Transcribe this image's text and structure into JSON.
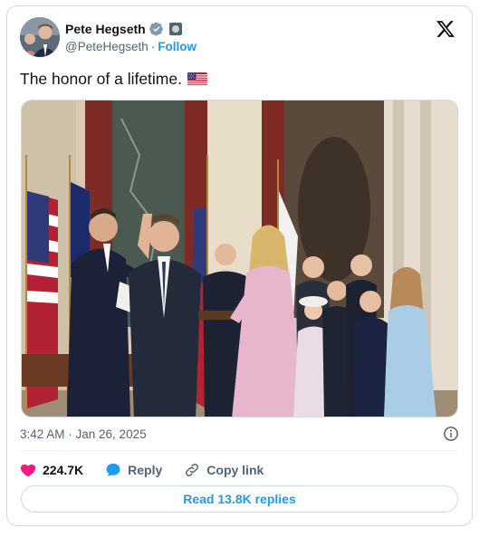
{
  "author": {
    "name": "Pete Hegseth",
    "handle": "@PeteHegseth",
    "separator": "·",
    "follow_label": "Follow"
  },
  "icons": {
    "verified": "verified-badge-icon",
    "affiliation": "government-badge-icon",
    "platform": "x-logo-icon",
    "info": "info-icon",
    "like": "heart-icon",
    "reply": "reply-bubble-icon",
    "copy": "link-icon"
  },
  "tweet": {
    "text": "The honor of a lifetime.",
    "emoji": "us-flag"
  },
  "meta": {
    "timestamp": "3:42 AM · Jan 26, 2025"
  },
  "actions": {
    "likes": "224.7K",
    "reply_label": "Reply",
    "copy_label": "Copy link"
  },
  "footer": {
    "read_replies": "Read 13.8K replies"
  },
  "colors": {
    "accent": "#1d9bf0",
    "like": "#f91880",
    "text_secondary": "#536471",
    "border": "#cfd9de"
  }
}
